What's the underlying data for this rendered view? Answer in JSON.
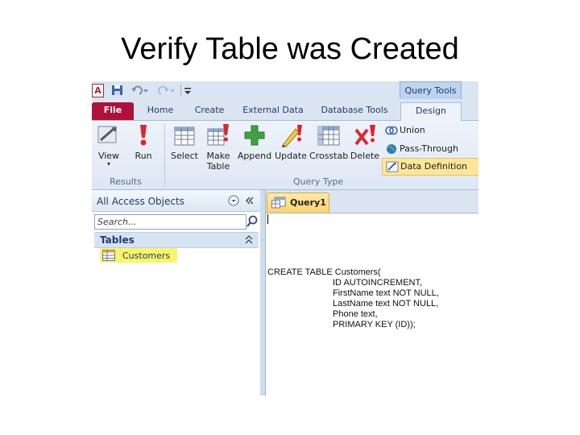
{
  "slide": {
    "title": "Verify Table was Created"
  },
  "app": {
    "logo_letter": "A",
    "context_tab": "Query Tools",
    "tabs": [
      "File",
      "Home",
      "Create",
      "External Data",
      "Database Tools",
      "Design"
    ],
    "active_tab": "Design"
  },
  "ribbon": {
    "results": {
      "view_label": "View",
      "run_label": "Run",
      "group_label": "Results"
    },
    "query_type": {
      "select_label": "Select",
      "make_table_label_1": "Make",
      "make_table_label_2": "Table",
      "append_label": "Append",
      "update_label": "Update",
      "crosstab_label": "Crosstab",
      "delete_label": "Delete",
      "union_label": "Union",
      "pass_through_label": "Pass-Through",
      "data_definition_label": "Data Definition",
      "group_label": "Query Type"
    }
  },
  "nav_pane": {
    "title": "All Access Objects",
    "search_placeholder": "Search...",
    "category": "Tables",
    "items": [
      "Customers"
    ]
  },
  "document": {
    "tab_label": "Query1",
    "sql_lines": [
      "CREATE TABLE Customers(",
      "ID AUTOINCREMENT,",
      "FirstName text NOT NULL,",
      "LastName text NOT NULL,",
      "Phone text,",
      "PRIMARY KEY (ID));"
    ]
  },
  "colors": {
    "file_tab": "#b0113a",
    "highlight": "#f9f56a",
    "active_button": "#fde69a"
  }
}
